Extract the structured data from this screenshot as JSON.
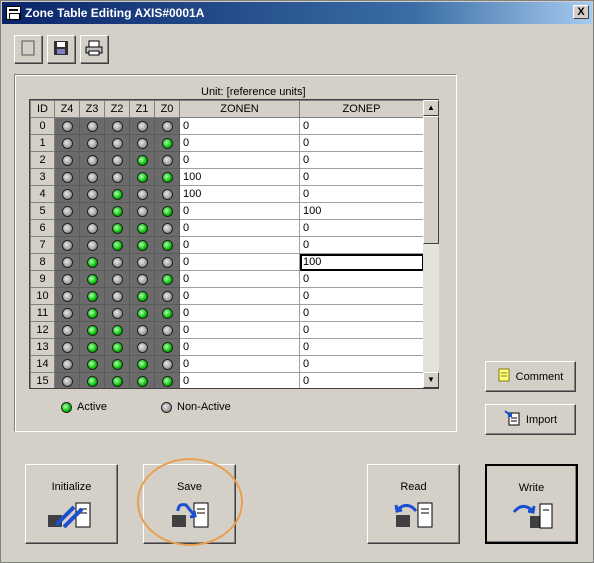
{
  "window": {
    "title": "Zone Table Editing AXIS#0001A",
    "close_label": "X"
  },
  "toolbar": [
    {
      "name": "new-icon"
    },
    {
      "name": "save-icon"
    },
    {
      "name": "print-icon"
    }
  ],
  "table": {
    "unit_label": "Unit:  [reference units]",
    "headers": [
      "ID",
      "Z4",
      "Z3",
      "Z2",
      "Z1",
      "Z0",
      "ZONEN",
      "ZONEP"
    ],
    "selected_cell": {
      "row": 8,
      "col": "ZONEP"
    },
    "rows": [
      {
        "id": "0",
        "z": [
          0,
          0,
          0,
          0,
          0
        ],
        "zonen": "0",
        "zonep": "0"
      },
      {
        "id": "1",
        "z": [
          0,
          0,
          0,
          0,
          1
        ],
        "zonen": "0",
        "zonep": "0"
      },
      {
        "id": "2",
        "z": [
          0,
          0,
          0,
          1,
          0
        ],
        "zonen": "0",
        "zonep": "0"
      },
      {
        "id": "3",
        "z": [
          0,
          0,
          0,
          1,
          1
        ],
        "zonen": "100",
        "zonep": "0"
      },
      {
        "id": "4",
        "z": [
          0,
          0,
          1,
          0,
          0
        ],
        "zonen": "100",
        "zonep": "0"
      },
      {
        "id": "5",
        "z": [
          0,
          0,
          1,
          0,
          1
        ],
        "zonen": "0",
        "zonep": "100"
      },
      {
        "id": "6",
        "z": [
          0,
          0,
          1,
          1,
          0
        ],
        "zonen": "0",
        "zonep": "0"
      },
      {
        "id": "7",
        "z": [
          0,
          0,
          1,
          1,
          1
        ],
        "zonen": "0",
        "zonep": "0"
      },
      {
        "id": "8",
        "z": [
          0,
          1,
          0,
          0,
          0
        ],
        "zonen": "0",
        "zonep": "100"
      },
      {
        "id": "9",
        "z": [
          0,
          1,
          0,
          0,
          1
        ],
        "zonen": "0",
        "zonep": "0"
      },
      {
        "id": "10",
        "z": [
          0,
          1,
          0,
          1,
          0
        ],
        "zonen": "0",
        "zonep": "0"
      },
      {
        "id": "11",
        "z": [
          0,
          1,
          0,
          1,
          1
        ],
        "zonen": "0",
        "zonep": "0"
      },
      {
        "id": "12",
        "z": [
          0,
          1,
          1,
          0,
          0
        ],
        "zonen": "0",
        "zonep": "0"
      },
      {
        "id": "13",
        "z": [
          0,
          1,
          1,
          0,
          1
        ],
        "zonen": "0",
        "zonep": "0"
      },
      {
        "id": "14",
        "z": [
          0,
          1,
          1,
          1,
          0
        ],
        "zonen": "0",
        "zonep": "0"
      },
      {
        "id": "15",
        "z": [
          0,
          1,
          1,
          1,
          1
        ],
        "zonen": "0",
        "zonep": "0"
      }
    ]
  },
  "legend": {
    "active": "Active",
    "inactive": "Non-Active"
  },
  "side_buttons": {
    "comment": "Comment",
    "import": "Import"
  },
  "buttons": {
    "initialize": "Initialize",
    "save": "Save",
    "read": "Read",
    "write": "Write"
  },
  "colors": {
    "active_led": "#00c000",
    "inactive_led": "#a0a0a0",
    "highlight_ring": "#e8a050",
    "title_bar": "#0a246a"
  }
}
